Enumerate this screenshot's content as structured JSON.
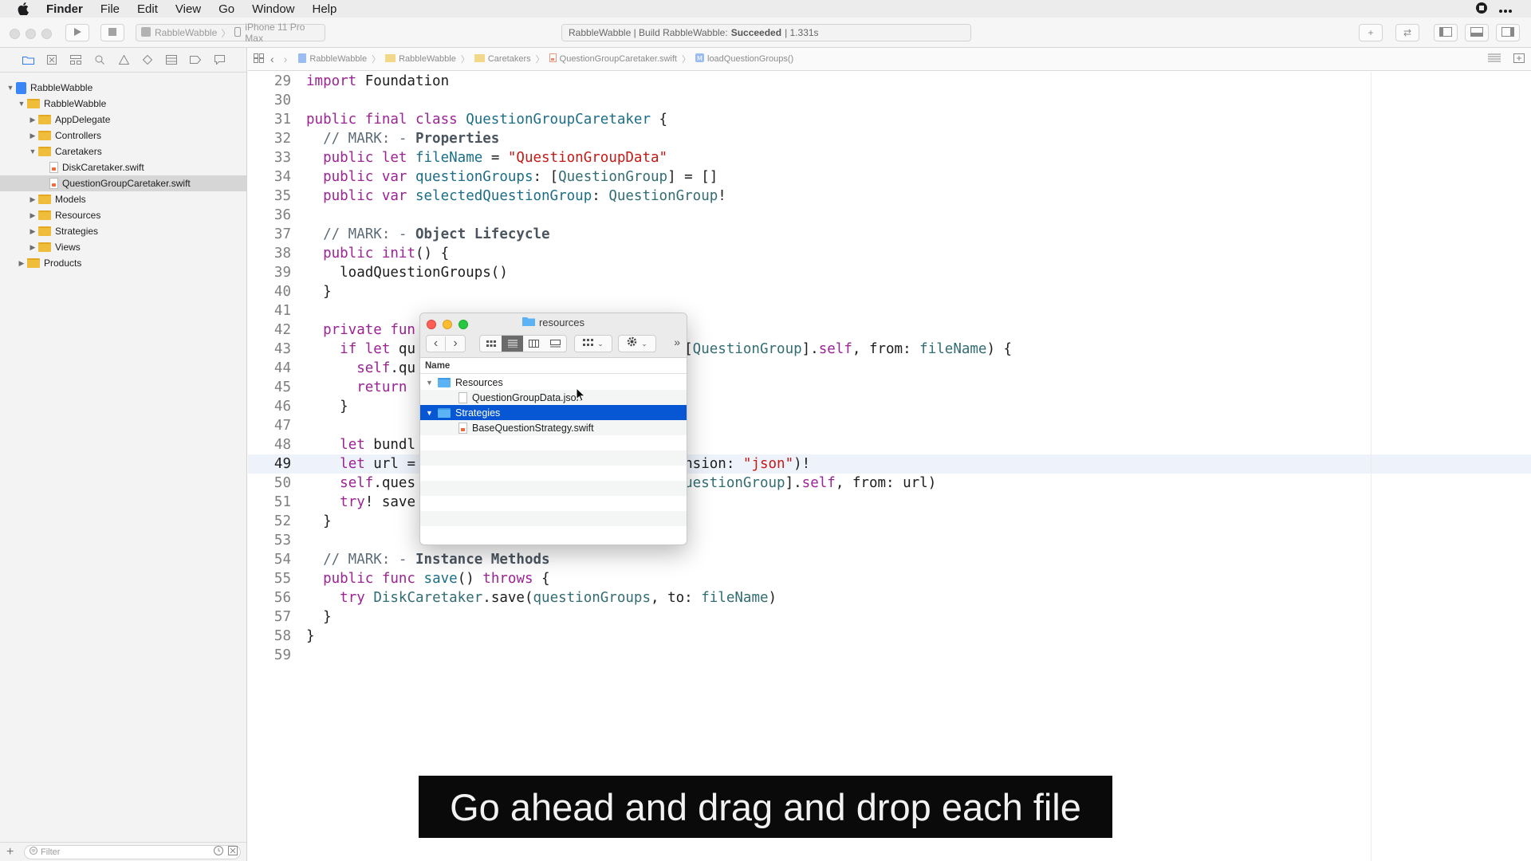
{
  "menubar": {
    "app": "Finder",
    "items": [
      "File",
      "Edit",
      "View",
      "Go",
      "Window",
      "Help"
    ]
  },
  "toolbar": {
    "scheme": "RabbleWabble",
    "device": "iPhone 11 Pro Max",
    "status_prefix": "RabbleWabble | Build RabbleWabble:",
    "status_result": "Succeeded",
    "status_time": "| 1.331s"
  },
  "navigator": {
    "items": [
      {
        "label": "RabbleWabble",
        "kind": "project",
        "depth": 0,
        "open": true
      },
      {
        "label": "RabbleWabble",
        "kind": "folder",
        "depth": 1,
        "open": true
      },
      {
        "label": "AppDelegate",
        "kind": "folder",
        "depth": 2,
        "open": false
      },
      {
        "label": "Controllers",
        "kind": "folder",
        "depth": 2,
        "open": false
      },
      {
        "label": "Caretakers",
        "kind": "folder",
        "depth": 2,
        "open": true
      },
      {
        "label": "DiskCaretaker.swift",
        "kind": "file",
        "depth": 3
      },
      {
        "label": "QuestionGroupCaretaker.swift",
        "kind": "file",
        "depth": 3,
        "selected": true
      },
      {
        "label": "Models",
        "kind": "folder",
        "depth": 2,
        "open": false
      },
      {
        "label": "Resources",
        "kind": "folder",
        "depth": 2,
        "open": false
      },
      {
        "label": "Strategies",
        "kind": "folder",
        "depth": 2,
        "open": false
      },
      {
        "label": "Views",
        "kind": "folder",
        "depth": 2,
        "open": false
      },
      {
        "label": "Products",
        "kind": "folder",
        "depth": 1,
        "open": false
      }
    ],
    "filter_placeholder": "Filter"
  },
  "jumpbar": {
    "crumbs": [
      "RabbleWabble",
      "RabbleWabble",
      "Caretakers",
      "QuestionGroupCaretaker.swift",
      "loadQuestionGroups()"
    ]
  },
  "editor": {
    "current_line": 49,
    "lines": [
      {
        "n": 29,
        "html": "<span class=\"kw\">import</span> Foundation"
      },
      {
        "n": 30,
        "html": ""
      },
      {
        "n": 31,
        "html": "<span class=\"kw\">public final class</span> <span class=\"ty\">QuestionGroupCaretaker</span> {"
      },
      {
        "n": 32,
        "html": "  <span class=\"cm\">// MARK: - </span><span class=\"mark\">Properties</span>"
      },
      {
        "n": 33,
        "html": "  <span class=\"kw\">public let</span> <span class=\"ty\">fileName</span> = <span class=\"st\">\"QuestionGroupData\"</span>"
      },
      {
        "n": 34,
        "html": "  <span class=\"kw\">public var</span> <span class=\"ty\">questionGroups</span>: [<span class=\"fn\">QuestionGroup</span>] = []"
      },
      {
        "n": 35,
        "html": "  <span class=\"kw\">public var</span> <span class=\"ty\">selectedQuestionGroup</span>: <span class=\"fn\">QuestionGroup</span>!"
      },
      {
        "n": 36,
        "html": ""
      },
      {
        "n": 37,
        "html": "  <span class=\"cm\">// MARK: - </span><span class=\"mark\">Object Lifecycle</span>"
      },
      {
        "n": 38,
        "html": "  <span class=\"kw\">public</span> <span class=\"kw\">init</span>() {"
      },
      {
        "n": 39,
        "html": "    loadQuestionGroups()"
      },
      {
        "n": 40,
        "html": "  }"
      },
      {
        "n": 41,
        "html": ""
      },
      {
        "n": 42,
        "html": "  <span class=\"kw\">private fun</span>"
      },
      {
        "n": 43,
        "html": "    <span class=\"kw\">if let</span> qu                   ker.retrieve([<span class=\"fn\">QuestionGroup</span>].<span class=\"kw\">self</span>, from: <span class=\"fn\">fileName</span>) {"
      },
      {
        "n": 44,
        "html": "      <span class=\"kw\">self</span>.qu"
      },
      {
        "n": 45,
        "html": "      <span class=\"kw\">return</span>"
      },
      {
        "n": 46,
        "html": "    }"
      },
      {
        "n": 47,
        "html": ""
      },
      {
        "n": 48,
        "html": "    <span class=\"kw\">let</span> bundl"
      },
      {
        "n": 49,
        "html": "    <span class=\"kw\">let</span> url =                   <span class=\"fn\">ame</span>, withExtension: <span class=\"st\">\"json\"</span>)!"
      },
      {
        "n": 50,
        "html": "    <span class=\"kw\">self</span>.ques                   r.retrieve([<span class=\"fn\">QuestionGroup</span>].<span class=\"kw\">self</span>, from: url)"
      },
      {
        "n": 51,
        "html": "    <span class=\"kw\">try</span>! save"
      },
      {
        "n": 52,
        "html": "  }"
      },
      {
        "n": 53,
        "html": ""
      },
      {
        "n": 54,
        "html": "  <span class=\"cm\">// MARK: - </span><span class=\"mark\">Instance Methods</span>"
      },
      {
        "n": 55,
        "html": "  <span class=\"kw\">public func</span> <span class=\"ty\">save</span>() <span class=\"kw\">throws</span> {"
      },
      {
        "n": 56,
        "html": "    <span class=\"kw\">try</span> <span class=\"fn\">DiskCaretaker</span>.save(<span class=\"fn\">questionGroups</span>, to: <span class=\"fn\">fileName</span>)"
      },
      {
        "n": 57,
        "html": "  }"
      },
      {
        "n": 58,
        "html": "}"
      },
      {
        "n": 59,
        "html": ""
      }
    ]
  },
  "finder": {
    "title": "resources",
    "column_header": "Name",
    "rows": [
      {
        "label": "Resources",
        "kind": "folder",
        "open": true
      },
      {
        "label": "QuestionGroupData.json",
        "kind": "doc"
      },
      {
        "label": "Strategies",
        "kind": "folder",
        "open": true,
        "selected": true
      },
      {
        "label": "BaseQuestionStrategy.swift",
        "kind": "swift"
      }
    ]
  },
  "caption": "Go ahead and drag and drop each file",
  "colors": {
    "selection": "#0756d3",
    "folder": "#f0bd3b",
    "finder_folder": "#5bb3f5"
  }
}
